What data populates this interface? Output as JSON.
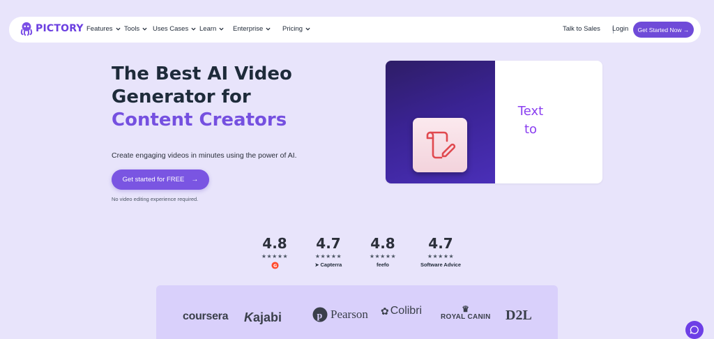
{
  "brand": {
    "name": "PICTORY",
    "accent": "#6f4bd8"
  },
  "nav": {
    "items": [
      {
        "label": "Features"
      },
      {
        "label": "Tools"
      },
      {
        "label": "Uses Cases"
      },
      {
        "label": "Learn"
      },
      {
        "label": "Enterprise"
      },
      {
        "label": "Pricing"
      }
    ],
    "talk_to_sales": "Talk to Sales",
    "login": "Login",
    "cta": "Get Started Now →"
  },
  "hero": {
    "headline_line1": "The Best AI Video",
    "headline_line2": "Generator for",
    "headline_accent": "Content Creators",
    "subtext": "Create engaging videos in minutes using the power of AI.",
    "cta": "Get started for FREE",
    "cta_icon": "arrow-right-icon",
    "note": "No video editing experience required."
  },
  "media": {
    "caption_line1": "Text",
    "caption_line2": "to",
    "icon": "script-pencil-icon",
    "caption_color": "#8a3ff0"
  },
  "ratings": [
    {
      "score": "4.8",
      "stars": "★★★★★",
      "source": "G"
    },
    {
      "score": "4.7",
      "stars": "★★★★★",
      "source": "Capterra"
    },
    {
      "score": "4.8",
      "stars": "★★★★★",
      "source": "feefo"
    },
    {
      "score": "4.7",
      "stars": "★★★★★",
      "source": "Software Advice"
    }
  ],
  "clients": [
    "coursera",
    "kajabi",
    "Pearson",
    "Colibri",
    "ROYAL CANIN",
    "D2L"
  ],
  "chat": {
    "icon": "chat-bubble-icon"
  }
}
